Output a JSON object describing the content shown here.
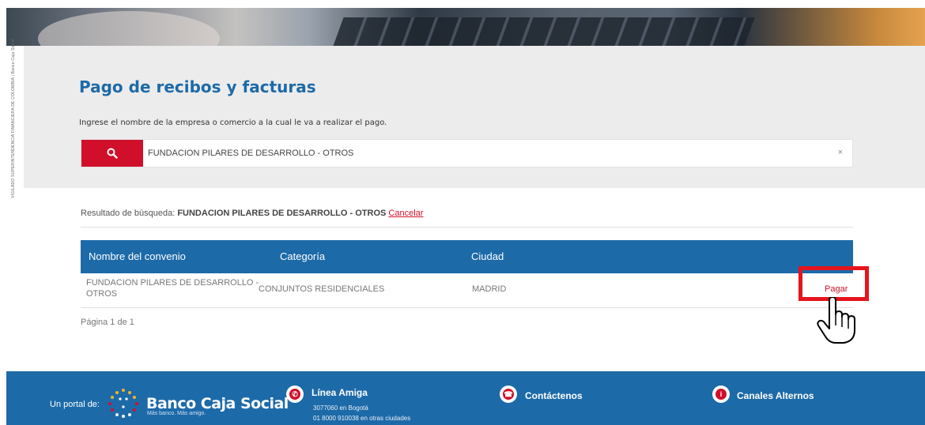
{
  "side_label": "VIGILADO SUPERINTENDENCIA FINANCIERA DE COLOMBIA | Banco Caja Social",
  "page_title": "Pago de recibos y facturas",
  "search": {
    "prompt": "Ingrese el nombre de la empresa o comercio a la cual le va a realizar el pago.",
    "value": "FUNDACION PILARES DE DESARROLLO - OTROS",
    "clear_label": "×"
  },
  "results": {
    "prefix": "Resultado de búsqueda: ",
    "query": "FUNDACION PILARES DE DESARROLLO - OTROS",
    "cancel_label": "Cancelar"
  },
  "table": {
    "columns": [
      "Nombre del convenio",
      "Categoría",
      "Ciudad"
    ],
    "rows": [
      {
        "name_line1": "FUNDACION PILARES DE DESARROLLO -",
        "name_line2": "OTROS",
        "category": "CONJUNTOS RESIDENCIALES",
        "city": "MADRID",
        "action": "Pagar"
      }
    ]
  },
  "pagination": "Página 1 de 1",
  "footer": {
    "portal_label": "Un portal de:",
    "brand": "Banco Caja Social",
    "tagline": "Más banco. Más amigo.",
    "linea_amiga": {
      "title": "Línea Amiga",
      "line1": "3077060 en Bogotá",
      "line2": "01 8000 910038 en otras ciudades"
    },
    "contact": "Contáctenos",
    "canales": "Canales Alternos"
  },
  "colors": {
    "primary_blue": "#1d6aa8",
    "accent_red": "#d0102a",
    "highlight_red": "#e5141d",
    "panel_gray": "#ececec"
  },
  "icons": [
    "search-icon",
    "clear-icon",
    "hand-pointer-icon",
    "phone-icon",
    "chat-icon",
    "info-icon"
  ]
}
